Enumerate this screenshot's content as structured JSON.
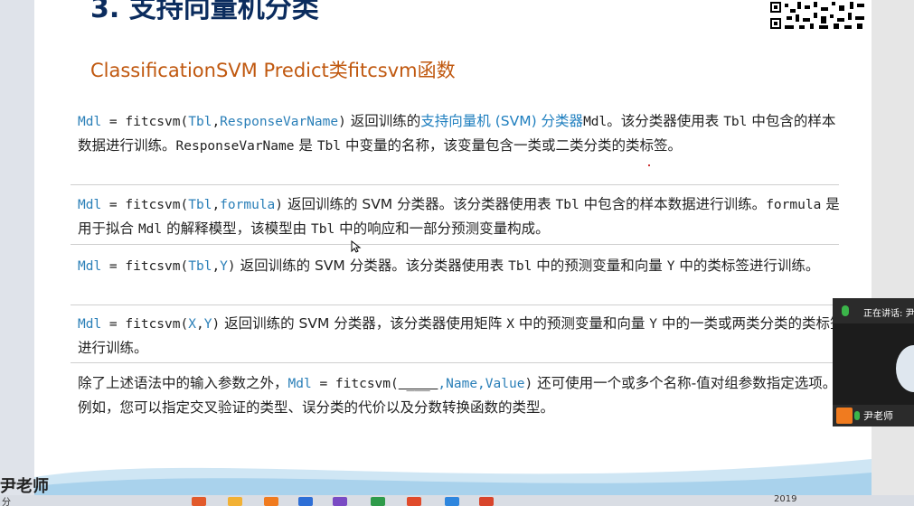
{
  "slide": {
    "heading": "3. 支持向量机分类",
    "subtitle": "ClassificationSVM Predict类fitcsvm函数",
    "para1": {
      "c1": "Mdl",
      "c2": " = fitcsvm(",
      "c3": "Tbl",
      "c4": ",",
      "c5": "ResponseVarName",
      "c6": ")",
      "t1": " 返回训练的",
      "link": "支持向量机 (SVM) 分类器",
      "c7": "Mdl",
      "t2": "。该分类器使用表 ",
      "c8": "Tbl",
      "t3": " 中包含的样本数据进行训练。",
      "c9": "ResponseVarName",
      "t4": " 是 ",
      "c10": "Tbl",
      "t5": " 中变量的名称，该变量包含一类或二类分类的类标签。"
    },
    "para2": {
      "c1": "Mdl",
      "c2": " = fitcsvm(",
      "c3": "Tbl",
      "c4": ",",
      "c5": "formula",
      "c6": ")",
      "t1": " 返回训练的 SVM 分类器。该分类器使用表 ",
      "c7": "Tbl",
      "t2": " 中包含的样本数据进行训练。",
      "c8": "formula",
      "t3": " 是用于拟合 ",
      "c9": "Mdl",
      "t4": " 的解释模型，该模型由 ",
      "c10": "Tbl",
      "t5": " 中的响应和一部分预测变量构成。"
    },
    "para3": {
      "c1": "Mdl",
      "c2": " = fitcsvm(",
      "c3": "Tbl",
      "c4": ",",
      "c5": "Y",
      "c6": ")",
      "t1": " 返回训练的 SVM 分类器。该分类器使用表 ",
      "c7": "Tbl",
      "t2": " 中的预测变量和向量 ",
      "c8": "Y",
      "t3": " 中的类标签进行训练。"
    },
    "para4": {
      "c1": "Mdl",
      "c2": " = fitcsvm(",
      "c3": "X",
      "c4": ",",
      "c5": "Y",
      "c6": ")",
      "t1": " 返回训练的 SVM 分类器，该分类器使用矩阵 ",
      "c7": "X",
      "t2": " 中的预测变量和向量 ",
      "c8": "Y",
      "t3": " 中的一类或两类分类的类标签进行训练。"
    },
    "para5": {
      "t1": "除了上述语法中的输入参数之外，",
      "c1": "Mdl",
      "c2": " = fitcsvm(",
      "c3": " ___ ",
      "c4": ",Name,Value",
      "c5": ")",
      "t2": " 还可使用一个或多个名称-值对组参数指定选项。例如，您可以指定交叉验证的类型、误分类的代价以及分数转换函数的类型。"
    }
  },
  "video": {
    "speaking_label": "正在讲话: 尹老",
    "presenter_name": "尹老师"
  },
  "watermark": "尹老师",
  "taskbar": {
    "left_text": "分 ",
    "clock": "2019"
  },
  "colors": {
    "heading": "#0b2c5e",
    "subtitle": "#c0580f",
    "code_blue": "#2a7fb8",
    "link": "#1f7fbf"
  }
}
